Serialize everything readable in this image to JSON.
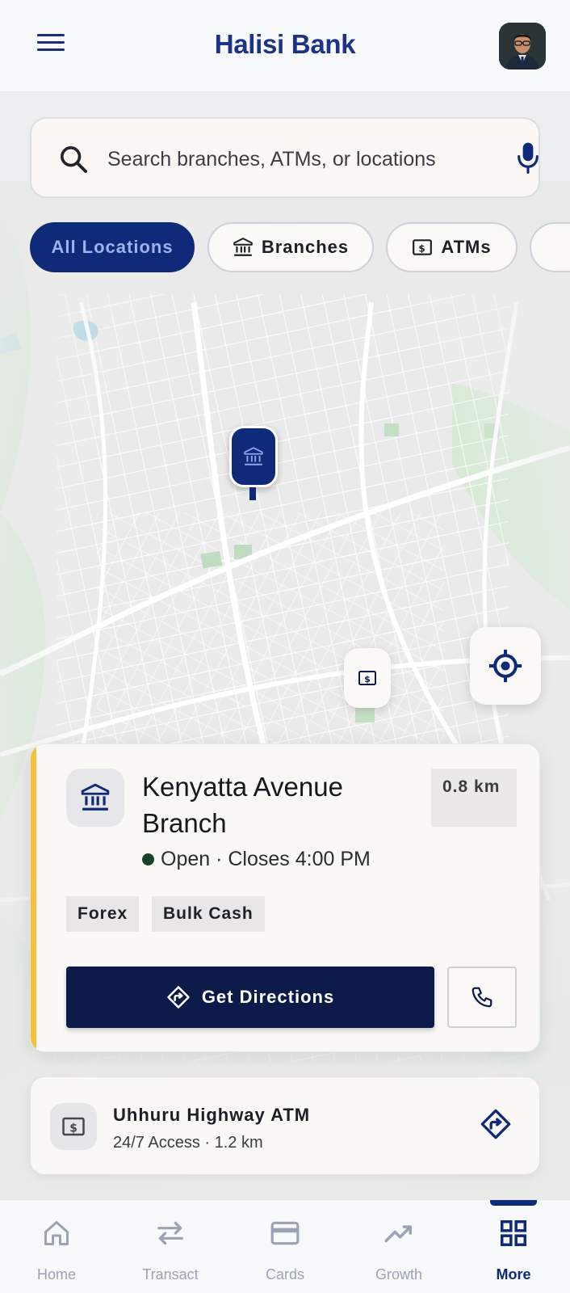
{
  "header": {
    "title": "Halisi Bank"
  },
  "search": {
    "placeholder": "Search branches, ATMs, or locations"
  },
  "filters": [
    {
      "label": "All Locations",
      "active": true
    },
    {
      "label": "Branches",
      "active": false
    },
    {
      "label": "ATMs",
      "active": false
    }
  ],
  "branch_card": {
    "name": "Kenyatta Avenue Branch",
    "distance": "0.8 km",
    "status": "Open · Closes 4:00 PM",
    "tags": [
      "Forex",
      "Bulk Cash"
    ],
    "directions_label": "Get Directions"
  },
  "atm_card": {
    "name": "Uhhuru Highway ATM",
    "details": "24/7 Access · 1.2 km"
  },
  "bottom_nav": [
    {
      "label": "Home",
      "icon": "home-icon",
      "active": false
    },
    {
      "label": "Transact",
      "icon": "transfer-icon",
      "active": false
    },
    {
      "label": "Cards",
      "icon": "card-icon",
      "active": false
    },
    {
      "label": "Growth",
      "icon": "trend-icon",
      "active": false
    },
    {
      "label": "More",
      "icon": "grid-icon",
      "active": true
    }
  ],
  "colors": {
    "primary": "#0e2a78",
    "dark_button": "#0c1a4a",
    "accent_yellow": "#f4c13a",
    "open_status": "#15432a"
  }
}
